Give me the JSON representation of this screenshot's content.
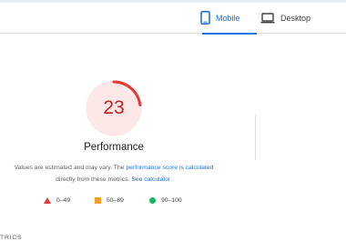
{
  "device_tabs": {
    "mobile_label": "Mobile",
    "desktop_label": "Desktop",
    "selected": "mobile",
    "accent_color": "#1a73e8"
  },
  "performance": {
    "score": "23",
    "score_fraction": 0.23,
    "title": "Performance",
    "desc_prefix": "Values are estimated and may vary. The ",
    "desc_link1": "performance score is calculated",
    "desc_middle": " directly from these metrics. ",
    "desc_link2": "See calculator.",
    "fail_color": "#c5221f",
    "fail_bg_color": "#fce8e6"
  },
  "legend": {
    "poor": {
      "label": "0–49",
      "color": "#e53935",
      "icon": "triangle-icon"
    },
    "average": {
      "label": "50–89",
      "color": "#fb9b25",
      "icon": "square-icon"
    },
    "good": {
      "label": "90–100",
      "color": "#18b663",
      "icon": "circle-icon"
    }
  },
  "metrics_heading": "TRICS"
}
